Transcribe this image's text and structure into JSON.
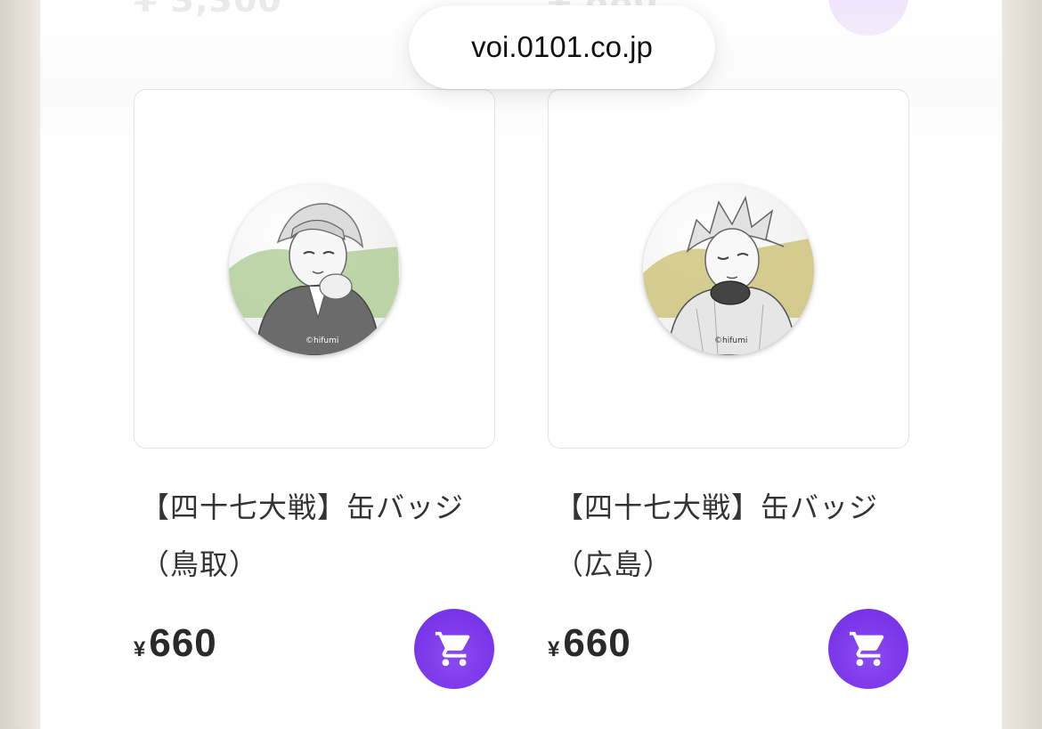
{
  "browser": {
    "url": "voi.0101.co.jp"
  },
  "colors": {
    "accent": "#7b37ea",
    "card_border": "#e3e3e3",
    "text": "#333333"
  },
  "products": [
    {
      "title_line1": "【四十七大戦】缶バッジ",
      "title_line2": "（鳥取）",
      "currency": "¥",
      "price": "660",
      "image_icon": "can-badge-tottori",
      "badge_accent": "#a9c98f",
      "cart_icon": "cart-icon"
    },
    {
      "title_line1": "【四十七大戦】缶バッジ",
      "title_line2": "（広島）",
      "currency": "¥",
      "price": "660",
      "image_icon": "can-badge-hiroshima",
      "badge_accent": "#c9bd6e",
      "cart_icon": "cart-icon"
    }
  ]
}
